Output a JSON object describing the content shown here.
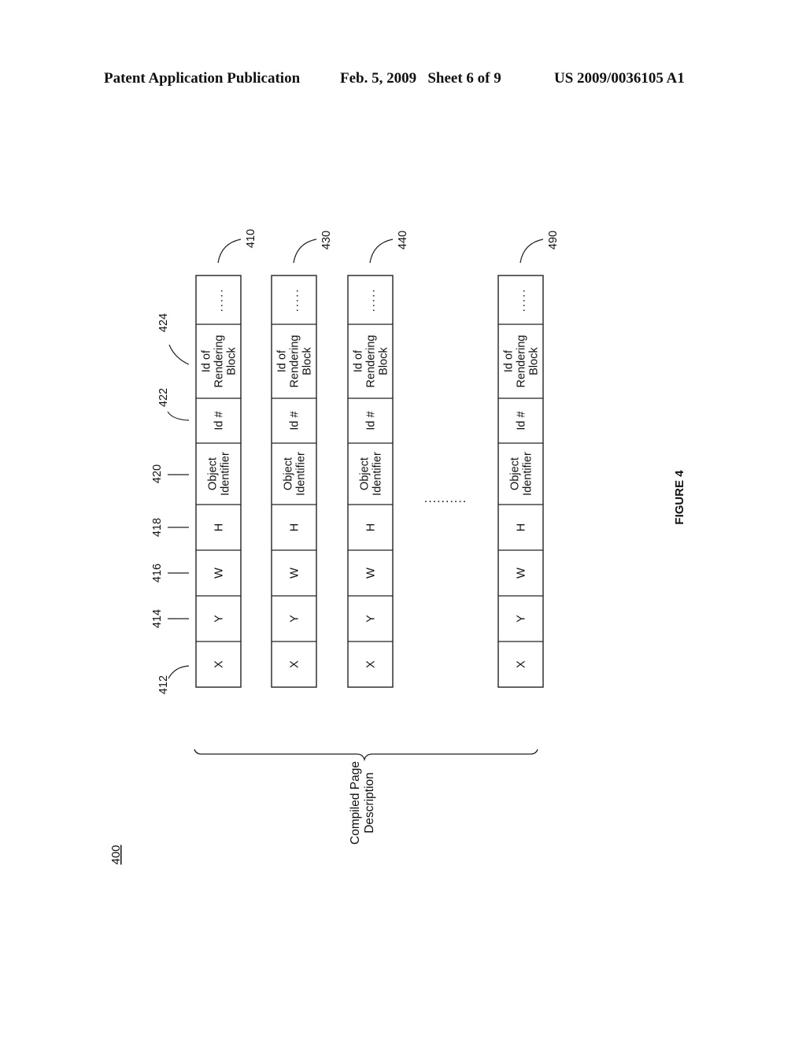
{
  "header": {
    "publication": "Patent Application Publication",
    "date_sheet": "Feb. 5, 2009   Sheet 6 of 9",
    "patent_number": "US 2009/0036105 A1"
  },
  "figure": {
    "label": "FIGURE 4",
    "ref_number": "400",
    "brace_label_line1": "Compiled Page",
    "brace_label_line2": "Description",
    "gap_ellipsis": "..........",
    "field_refs": [
      "412",
      "414",
      "416",
      "418",
      "420",
      "422",
      "424"
    ],
    "fields": [
      {
        "lines": [
          "X"
        ]
      },
      {
        "lines": [
          "Y"
        ]
      },
      {
        "lines": [
          "W"
        ]
      },
      {
        "lines": [
          "H"
        ]
      },
      {
        "lines": [
          "Object",
          "Identifier"
        ]
      },
      {
        "lines": [
          "Id #"
        ]
      },
      {
        "lines": [
          "Id of",
          "Rendering",
          "Block"
        ]
      },
      {
        "lines": [
          "....."
        ]
      }
    ],
    "records": [
      {
        "ref": "410"
      },
      {
        "ref": "430"
      },
      {
        "ref": "440"
      },
      {
        "ref": "490"
      }
    ]
  }
}
